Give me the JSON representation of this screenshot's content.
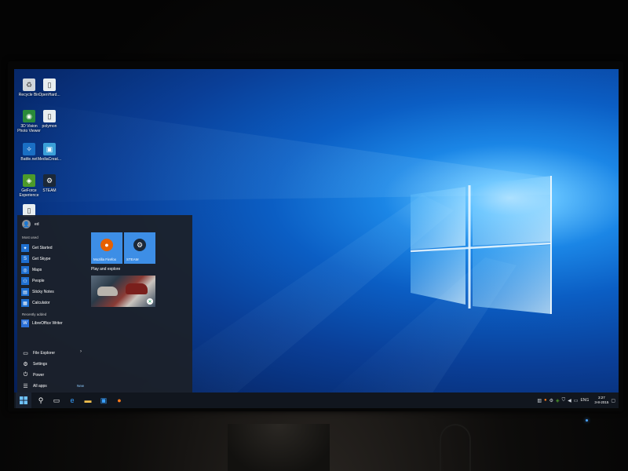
{
  "desktop": {
    "icons": [
      {
        "label": "Recycle Bin",
        "icon": "recycle-bin-icon"
      },
      {
        "label": "OpenHard...",
        "icon": "file-icon"
      },
      {
        "label": "3D Vision Photo Viewer",
        "icon": "3d-vision-icon"
      },
      {
        "label": "polymon",
        "icon": "file-icon"
      },
      {
        "label": "Battle.net",
        "icon": "battlenet-icon"
      },
      {
        "label": "MediaCreat...",
        "icon": "media-creation-icon"
      },
      {
        "label": "GeForce Experience",
        "icon": "geforce-icon"
      },
      {
        "label": "STEAM",
        "icon": "steam-icon"
      },
      {
        "label": "",
        "icon": "file-icon"
      }
    ]
  },
  "start_menu": {
    "user_name": "ed",
    "most_used_label": "Most used",
    "most_used": [
      {
        "label": "Get Started",
        "icon": "lightbulb-icon"
      },
      {
        "label": "Get Skype",
        "icon": "skype-icon"
      },
      {
        "label": "Maps",
        "icon": "map-icon"
      },
      {
        "label": "People",
        "icon": "people-icon"
      },
      {
        "label": "Sticky Notes",
        "icon": "sticky-note-icon"
      },
      {
        "label": "Calculator",
        "icon": "calculator-icon"
      }
    ],
    "recently_added_label": "Recently added",
    "recently_added": [
      {
        "label": "LibreOffice Writer",
        "icon": "libreoffice-writer-icon"
      }
    ],
    "system": [
      {
        "label": "File Explorer",
        "icon": "folder-icon"
      },
      {
        "label": "Settings",
        "icon": "gear-icon"
      },
      {
        "label": "Power",
        "icon": "power-icon"
      },
      {
        "label": "All apps",
        "icon": "list-icon"
      }
    ],
    "new_label": "New",
    "tiles": [
      {
        "label": "Mozilla Firefox",
        "icon": "firefox-icon"
      },
      {
        "label": "STEAM",
        "icon": "steam-icon"
      }
    ],
    "tile_group_label": "Play and explore",
    "xbox_tile": {
      "icon": "xbox-icon"
    }
  },
  "taskbar": {
    "buttons": [
      {
        "name": "start-button",
        "icon": "windows-logo-icon"
      },
      {
        "name": "search-button",
        "icon": "search-icon"
      },
      {
        "name": "task-view-button",
        "icon": "task-view-icon"
      },
      {
        "name": "edge-button",
        "icon": "edge-icon"
      },
      {
        "name": "file-explorer-button",
        "icon": "folder-icon"
      },
      {
        "name": "store-button",
        "icon": "store-icon"
      },
      {
        "name": "firefox-button",
        "icon": "firefox-icon"
      }
    ],
    "tray": {
      "language": "ENG",
      "time": "3:27",
      "date": "3-8-2015"
    }
  },
  "colors": {
    "accent": "#3d8ee6",
    "taskbar": "#11161e",
    "start_menu_bg": "#1c2028"
  }
}
